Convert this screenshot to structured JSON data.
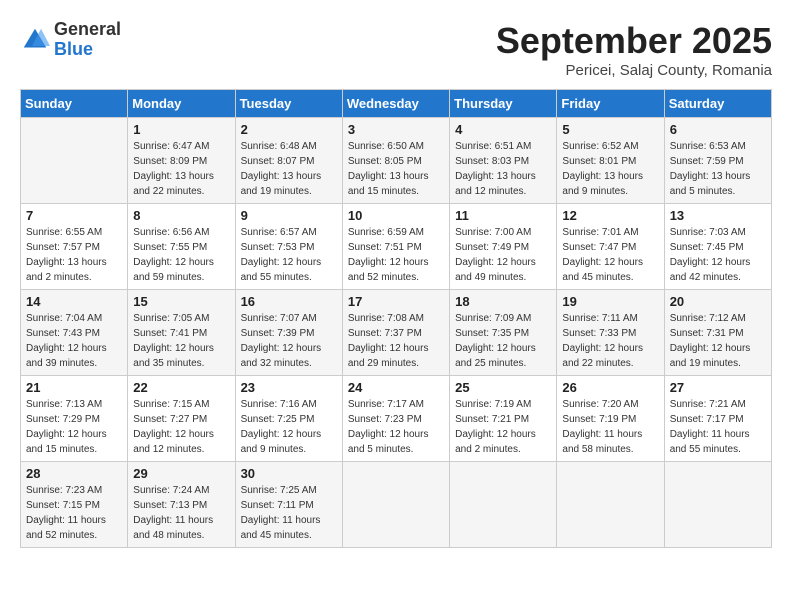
{
  "header": {
    "logo_general": "General",
    "logo_blue": "Blue",
    "month_title": "September 2025",
    "location": "Pericei, Salaj County, Romania"
  },
  "days_of_week": [
    "Sunday",
    "Monday",
    "Tuesday",
    "Wednesday",
    "Thursday",
    "Friday",
    "Saturday"
  ],
  "weeks": [
    [
      {
        "day": "",
        "info": ""
      },
      {
        "day": "1",
        "info": "Sunrise: 6:47 AM\nSunset: 8:09 PM\nDaylight: 13 hours\nand 22 minutes."
      },
      {
        "day": "2",
        "info": "Sunrise: 6:48 AM\nSunset: 8:07 PM\nDaylight: 13 hours\nand 19 minutes."
      },
      {
        "day": "3",
        "info": "Sunrise: 6:50 AM\nSunset: 8:05 PM\nDaylight: 13 hours\nand 15 minutes."
      },
      {
        "day": "4",
        "info": "Sunrise: 6:51 AM\nSunset: 8:03 PM\nDaylight: 13 hours\nand 12 minutes."
      },
      {
        "day": "5",
        "info": "Sunrise: 6:52 AM\nSunset: 8:01 PM\nDaylight: 13 hours\nand 9 minutes."
      },
      {
        "day": "6",
        "info": "Sunrise: 6:53 AM\nSunset: 7:59 PM\nDaylight: 13 hours\nand 5 minutes."
      }
    ],
    [
      {
        "day": "7",
        "info": "Sunrise: 6:55 AM\nSunset: 7:57 PM\nDaylight: 13 hours\nand 2 minutes."
      },
      {
        "day": "8",
        "info": "Sunrise: 6:56 AM\nSunset: 7:55 PM\nDaylight: 12 hours\nand 59 minutes."
      },
      {
        "day": "9",
        "info": "Sunrise: 6:57 AM\nSunset: 7:53 PM\nDaylight: 12 hours\nand 55 minutes."
      },
      {
        "day": "10",
        "info": "Sunrise: 6:59 AM\nSunset: 7:51 PM\nDaylight: 12 hours\nand 52 minutes."
      },
      {
        "day": "11",
        "info": "Sunrise: 7:00 AM\nSunset: 7:49 PM\nDaylight: 12 hours\nand 49 minutes."
      },
      {
        "day": "12",
        "info": "Sunrise: 7:01 AM\nSunset: 7:47 PM\nDaylight: 12 hours\nand 45 minutes."
      },
      {
        "day": "13",
        "info": "Sunrise: 7:03 AM\nSunset: 7:45 PM\nDaylight: 12 hours\nand 42 minutes."
      }
    ],
    [
      {
        "day": "14",
        "info": "Sunrise: 7:04 AM\nSunset: 7:43 PM\nDaylight: 12 hours\nand 39 minutes."
      },
      {
        "day": "15",
        "info": "Sunrise: 7:05 AM\nSunset: 7:41 PM\nDaylight: 12 hours\nand 35 minutes."
      },
      {
        "day": "16",
        "info": "Sunrise: 7:07 AM\nSunset: 7:39 PM\nDaylight: 12 hours\nand 32 minutes."
      },
      {
        "day": "17",
        "info": "Sunrise: 7:08 AM\nSunset: 7:37 PM\nDaylight: 12 hours\nand 29 minutes."
      },
      {
        "day": "18",
        "info": "Sunrise: 7:09 AM\nSunset: 7:35 PM\nDaylight: 12 hours\nand 25 minutes."
      },
      {
        "day": "19",
        "info": "Sunrise: 7:11 AM\nSunset: 7:33 PM\nDaylight: 12 hours\nand 22 minutes."
      },
      {
        "day": "20",
        "info": "Sunrise: 7:12 AM\nSunset: 7:31 PM\nDaylight: 12 hours\nand 19 minutes."
      }
    ],
    [
      {
        "day": "21",
        "info": "Sunrise: 7:13 AM\nSunset: 7:29 PM\nDaylight: 12 hours\nand 15 minutes."
      },
      {
        "day": "22",
        "info": "Sunrise: 7:15 AM\nSunset: 7:27 PM\nDaylight: 12 hours\nand 12 minutes."
      },
      {
        "day": "23",
        "info": "Sunrise: 7:16 AM\nSunset: 7:25 PM\nDaylight: 12 hours\nand 9 minutes."
      },
      {
        "day": "24",
        "info": "Sunrise: 7:17 AM\nSunset: 7:23 PM\nDaylight: 12 hours\nand 5 minutes."
      },
      {
        "day": "25",
        "info": "Sunrise: 7:19 AM\nSunset: 7:21 PM\nDaylight: 12 hours\nand 2 minutes."
      },
      {
        "day": "26",
        "info": "Sunrise: 7:20 AM\nSunset: 7:19 PM\nDaylight: 11 hours\nand 58 minutes."
      },
      {
        "day": "27",
        "info": "Sunrise: 7:21 AM\nSunset: 7:17 PM\nDaylight: 11 hours\nand 55 minutes."
      }
    ],
    [
      {
        "day": "28",
        "info": "Sunrise: 7:23 AM\nSunset: 7:15 PM\nDaylight: 11 hours\nand 52 minutes."
      },
      {
        "day": "29",
        "info": "Sunrise: 7:24 AM\nSunset: 7:13 PM\nDaylight: 11 hours\nand 48 minutes."
      },
      {
        "day": "30",
        "info": "Sunrise: 7:25 AM\nSunset: 7:11 PM\nDaylight: 11 hours\nand 45 minutes."
      },
      {
        "day": "",
        "info": ""
      },
      {
        "day": "",
        "info": ""
      },
      {
        "day": "",
        "info": ""
      },
      {
        "day": "",
        "info": ""
      }
    ]
  ]
}
